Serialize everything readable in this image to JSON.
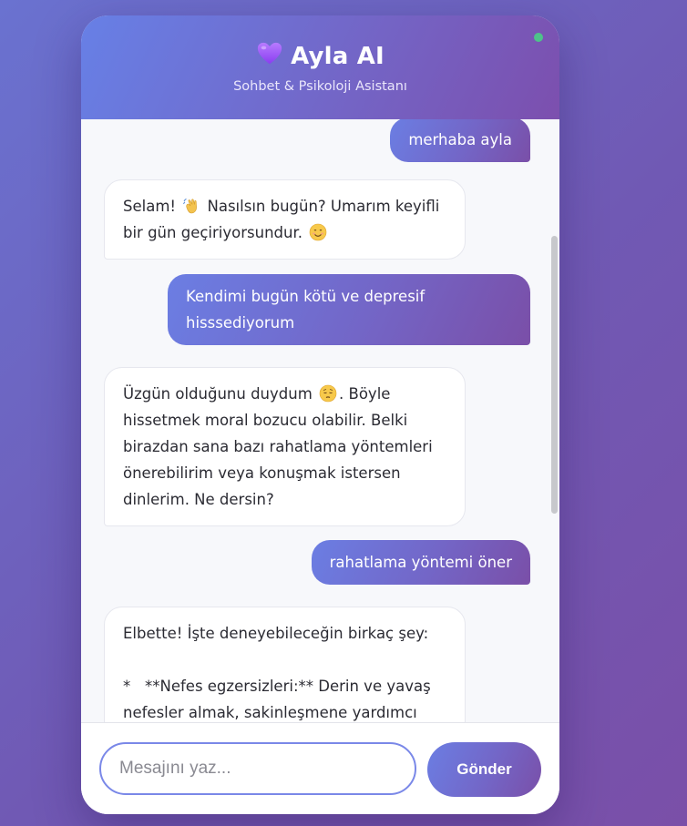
{
  "header": {
    "heart_icon": "purple-heart-icon",
    "title": "Ayla AI",
    "subtitle": "Sohbet & Psikoloji Asistanı",
    "status_color": "#4ec28a"
  },
  "messages": [
    {
      "role": "user",
      "text": "merhaba ayla"
    },
    {
      "role": "bot",
      "parts": {
        "a": "Selam! ",
        "emoji": "waving-hand-icon",
        "b": " Nasılsın bugün? Umarım keyifli bir gün geçiriyorsundur. ",
        "emoji2": "smiling-face-icon"
      }
    },
    {
      "role": "user",
      "text": "Kendimi bugün kötü ve depresif hisssediyorum"
    },
    {
      "role": "bot",
      "parts": {
        "a": "Üzgün olduğunu duydum ",
        "emoji": "pensive-face-icon",
        "b": ". Böyle hissetmek moral bozucu olabilir. Belki birazdan sana bazı rahatlama yöntemleri önerebilirim veya konuşmak istersen dinlerim. Ne dersin?"
      }
    },
    {
      "role": "user",
      "text": "rahatlama yöntemi öner"
    },
    {
      "role": "bot",
      "text": "Elbette! İşte deneyebileceğin birkaç şey:\n\n*   **Nefes egzersizleri:** Derin ve yavaş nefesler almak, sakinleşmene yardımcı"
    }
  ],
  "composer": {
    "placeholder": "Mesajını yaz...",
    "value": "",
    "send_label": "Gönder"
  },
  "colors": {
    "accent_start": "#6b7ee3",
    "accent_end": "#7a4fa8"
  }
}
